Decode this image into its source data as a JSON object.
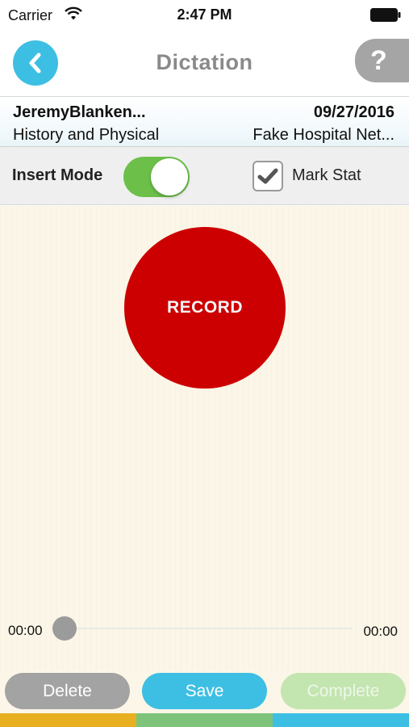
{
  "status_bar": {
    "carrier": "Carrier",
    "time": "2:47 PM",
    "wifi_icon": "wifi-icon",
    "battery_icon": "battery-icon"
  },
  "nav": {
    "title": "Dictation",
    "back_icon": "chevron-left-icon",
    "help_label": "?"
  },
  "patient": {
    "name": "JeremyBlanken...",
    "date": "09/27/2016",
    "document_type": "History and Physical",
    "facility": "Fake Hospital Net..."
  },
  "options": {
    "insert_mode_label": "Insert Mode",
    "insert_mode_on": true,
    "mark_stat_label": "Mark Stat",
    "mark_stat_checked": true
  },
  "recorder": {
    "record_label": "RECORD",
    "current_time": "00:00",
    "total_time": "00:00",
    "progress": 0
  },
  "actions": {
    "delete_label": "Delete",
    "save_label": "Save",
    "complete_label": "Complete"
  },
  "colors": {
    "accent_blue": "#3dbfe3",
    "record_red": "#cc0000",
    "toggle_green": "#6cc04a",
    "strip": [
      "#e8b020",
      "#7dc47a",
      "#3dbfe3"
    ]
  }
}
